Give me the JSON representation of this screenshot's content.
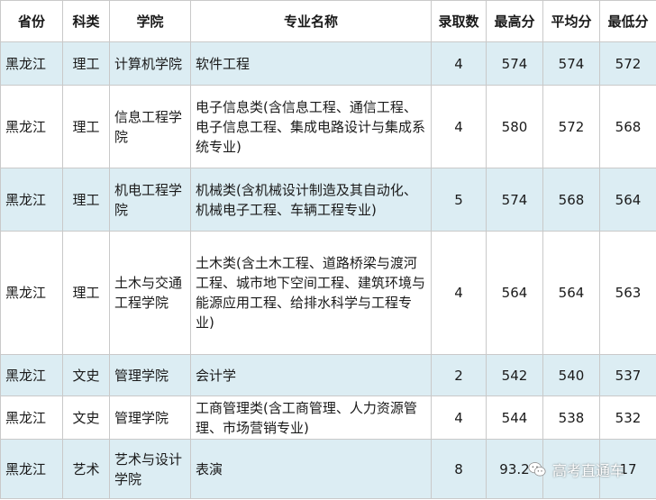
{
  "headers": [
    "省份",
    "科类",
    "学院",
    "专业名称",
    "录取数",
    "最高分",
    "平均分",
    "最低分"
  ],
  "rows": [
    {
      "province": "黑龙江",
      "category": "理工",
      "college": "计算机学院",
      "major": "软件工程",
      "count": "4",
      "max": "574",
      "avg": "574",
      "min": "572"
    },
    {
      "province": "黑龙江",
      "category": "理工",
      "college": "信息工程学院",
      "major": "电子信息类(含信息工程、通信工程、电子信息工程、集成电路设计与集成系统专业)",
      "count": "4",
      "max": "580",
      "avg": "572",
      "min": "568"
    },
    {
      "province": "黑龙江",
      "category": "理工",
      "college": "机电工程学院",
      "major": "机械类(含机械设计制造及其自动化、机械电子工程、车辆工程专业)",
      "count": "5",
      "max": "574",
      "avg": "568",
      "min": "564"
    },
    {
      "province": "黑龙江",
      "category": "理工",
      "college": "土木与交通工程学院",
      "major": "土木类(含土木工程、道路桥梁与渡河工程、城市地下空间工程、建筑环境与能源应用工程、给排水科学与工程专业)",
      "count": "4",
      "max": "564",
      "avg": "564",
      "min": "563"
    },
    {
      "province": "黑龙江",
      "category": "文史",
      "college": "管理学院",
      "major": "会计学",
      "count": "2",
      "max": "542",
      "avg": "540",
      "min": "537"
    },
    {
      "province": "黑龙江",
      "category": "文史",
      "college": "管理学院",
      "major": "工商管理类(含工商管理、人力资源管理、市场营销专业)",
      "count": "4",
      "max": "544",
      "avg": "538",
      "min": "532"
    },
    {
      "province": "黑龙江",
      "category": "艺术",
      "college": "艺术与设计学院",
      "major": "表演",
      "count": "8",
      "max": "93.2",
      "avg": "",
      "min": "17"
    }
  ],
  "watermark": {
    "text": "高考直通车",
    "icon": "wechat-icon"
  }
}
